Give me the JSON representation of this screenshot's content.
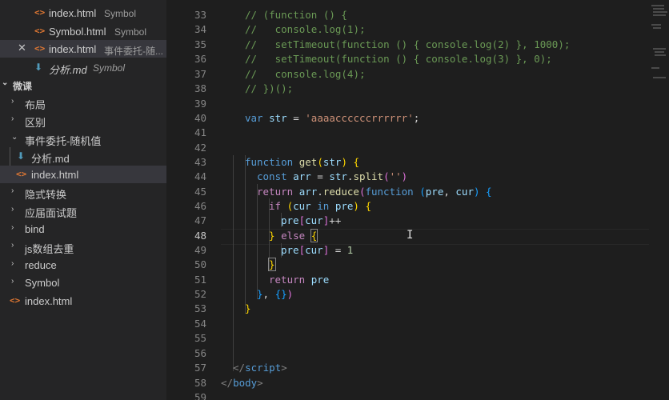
{
  "open_editors": [
    {
      "name": "index.html",
      "desc": "Symbol",
      "icon": "html-icon"
    },
    {
      "name": "Symbol.html",
      "desc": "Symbol",
      "icon": "html-icon"
    },
    {
      "name": "index.html",
      "desc": "事件委托-随...",
      "icon": "html-icon",
      "close": "✕"
    },
    {
      "name": "分析.md",
      "desc": "Symbol",
      "icon": "md-icon"
    }
  ],
  "explorer": {
    "section_title": "微课",
    "items": [
      {
        "label": "布局"
      },
      {
        "label": "区别"
      },
      {
        "label": "事件委托-随机值"
      },
      {
        "label": "分析.md"
      },
      {
        "label": "index.html"
      },
      {
        "label": "隐式转换"
      },
      {
        "label": "应届面试题"
      },
      {
        "label": "bind"
      },
      {
        "label": "js数组去重"
      },
      {
        "label": "reduce"
      },
      {
        "label": "Symbol"
      },
      {
        "label": "index.html"
      }
    ]
  },
  "editor": {
    "line_numbers": [
      "33",
      "34",
      "35",
      "36",
      "37",
      "38",
      "39",
      "40",
      "41",
      "42",
      "43",
      "44",
      "45",
      "46",
      "47",
      "48",
      "49",
      "50",
      "51",
      "52",
      "53",
      "54",
      "55",
      "56",
      "57",
      "58",
      "59"
    ],
    "active_line": "48",
    "code": {
      "l33": "// (function () {",
      "l34": "//   console.log(1);",
      "l35": "//   setTimeout(function () { console.log(2) }, 1000);",
      "l36": "//   setTimeout(function () { console.log(3) }, 0);",
      "l37": "//   console.log(4);",
      "l38": "// })();",
      "l40_var": "var",
      "l40_name": "str",
      "l40_eq": " = ",
      "l40_str": "'aaaaccccccrrrrrr'",
      "l40_semi": ";",
      "l43_kw": "function",
      "l43_fn": "get",
      "l43_param": "str",
      "l44_const": "const",
      "l44_arr": "arr",
      "l44_eq": " = ",
      "l44_obj": "str",
      "l44_split": "split",
      "l44_arg": "''",
      "l45_return": "return",
      "l45_arr": "arr",
      "l45_reduce": "reduce",
      "l45_function": "function",
      "l45_pre": "pre",
      "l45_cur": "cur",
      "l46_if": "if",
      "l46_cur": "cur",
      "l46_in": "in",
      "l46_pre": "pre",
      "l47_pre": "pre",
      "l47_cur": "cur",
      "l47_op": "++",
      "l48_else": "else",
      "l49_pre": "pre",
      "l49_cur": "cur",
      "l49_eq": " = ",
      "l49_num": "1",
      "l51_return": "return",
      "l51_pre": "pre",
      "l57_tag": "script",
      "l58_tag": "body"
    }
  }
}
